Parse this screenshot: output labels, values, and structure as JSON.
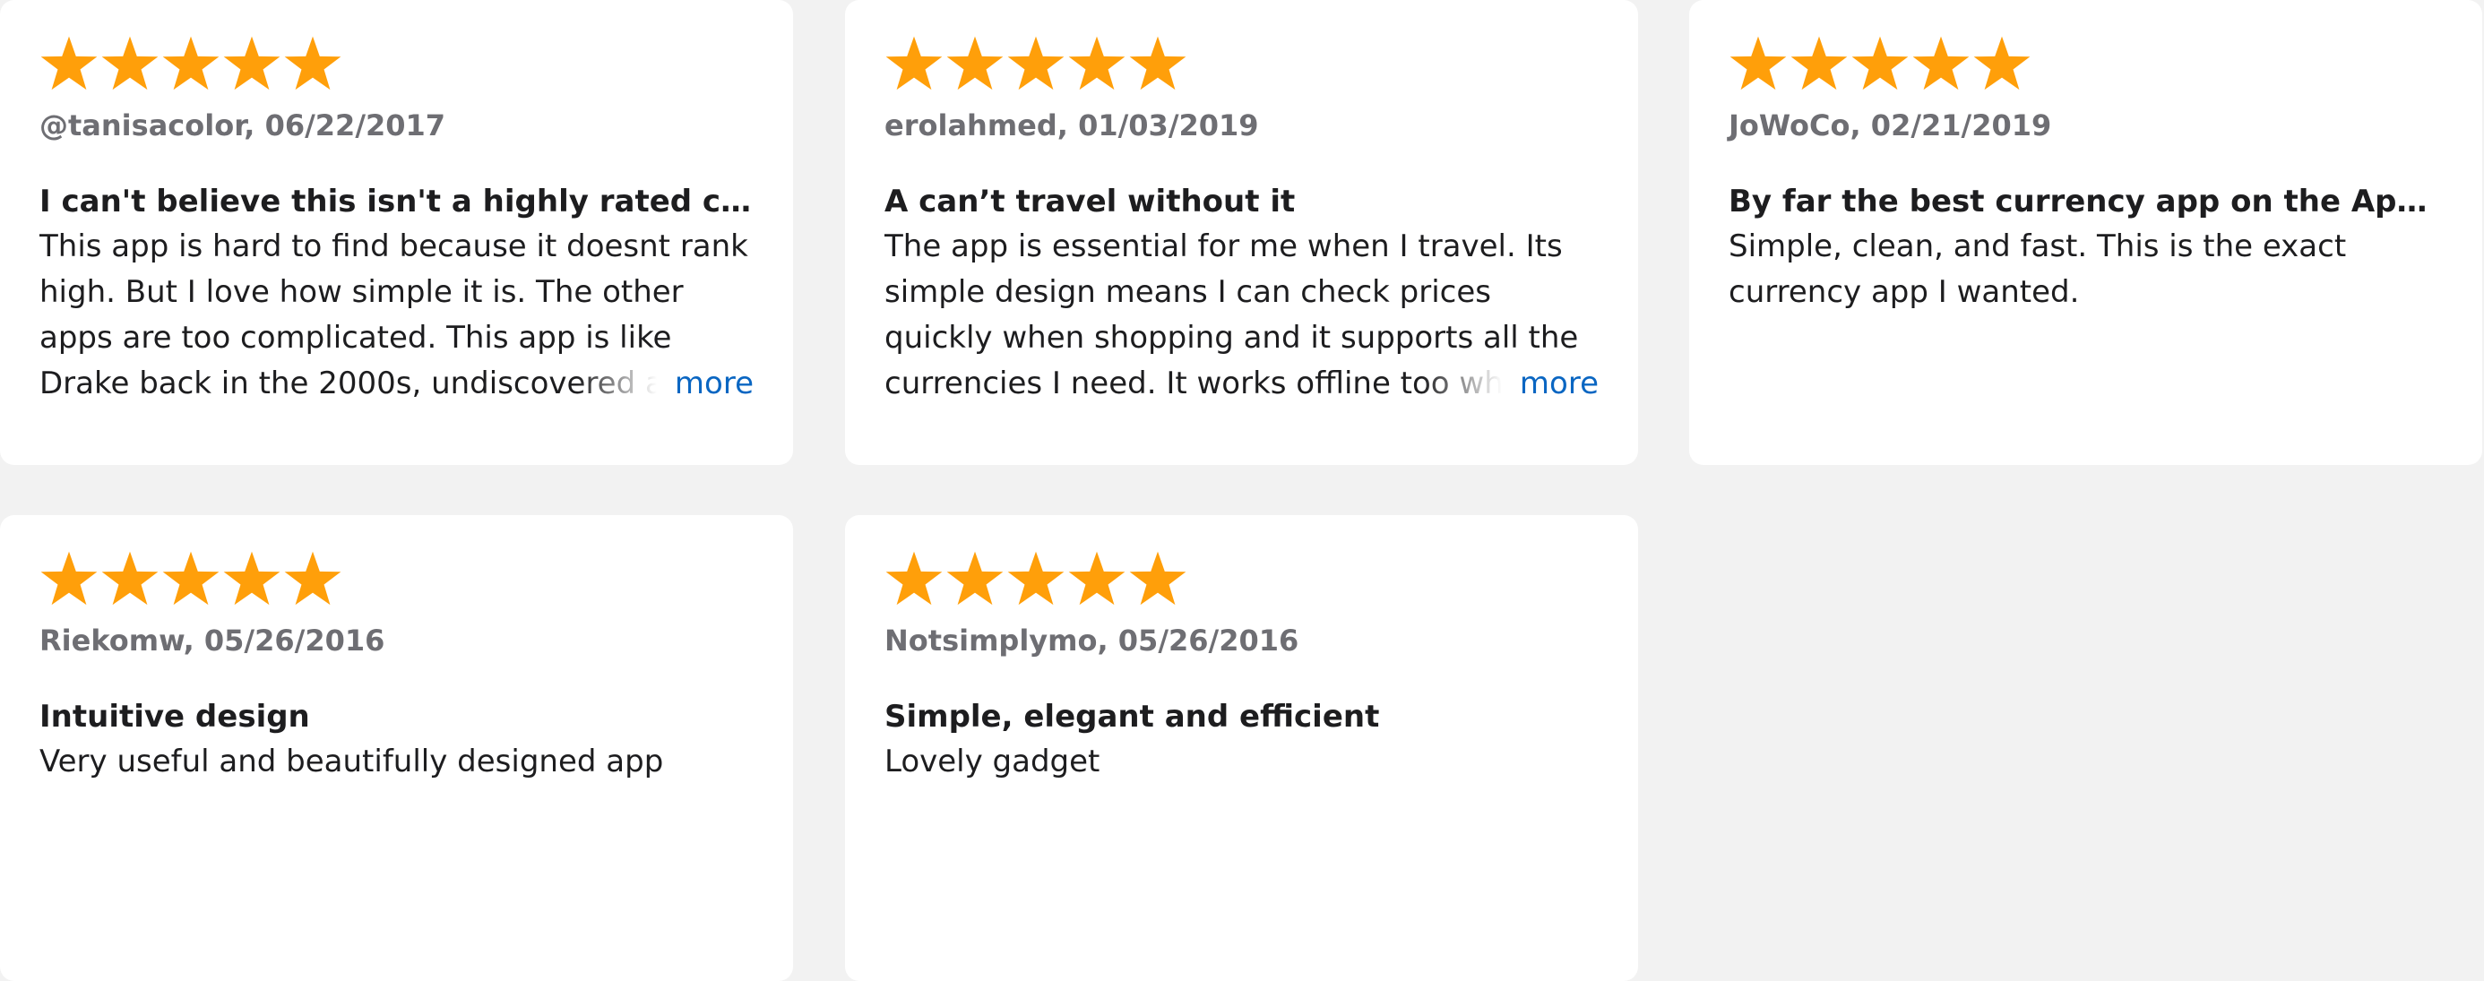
{
  "colors": {
    "star": "#ff9f0a",
    "more_link": "#0a66c2",
    "meta_text": "#6e6e73",
    "card_bg": "#ffffff",
    "page_bg": "#f2f2f2"
  },
  "icons": {
    "rating_star": "star-icon"
  },
  "reviews": [
    {
      "rating": 5,
      "author": "@tanisacolor",
      "date": "06/22/2017",
      "title": "I can't believe this isn't a highly rated currency app",
      "body": "This app is hard to find because it doesnt rank high. But I love how simple it is. The other apps are too complicated. This app is like Drake back in the 2000s, undiscovered and",
      "more_label": "more"
    },
    {
      "rating": 5,
      "author": "erolahmed",
      "date": "01/03/2019",
      "title": "A can’t travel without it",
      "body": "The app is essential for me when I travel. Its simple design means I can check prices quickly when shopping and it supports all the currencies I need. It works offline too which",
      "more_label": "more"
    },
    {
      "rating": 5,
      "author": "JoWoCo",
      "date": "02/21/2019",
      "title": "By far the best currency app on the App Store",
      "body": "Simple, clean, and fast. This is the exact currency app I wanted."
    },
    {
      "rating": 5,
      "author": "Riekomw",
      "date": "05/26/2016",
      "title": "Intuitive design",
      "body": "Very useful and beautifully designed app"
    },
    {
      "rating": 5,
      "author": "Notsimplymo",
      "date": "05/26/2016",
      "title": "Simple, elegant and efficient",
      "body": "Lovely gadget"
    }
  ]
}
